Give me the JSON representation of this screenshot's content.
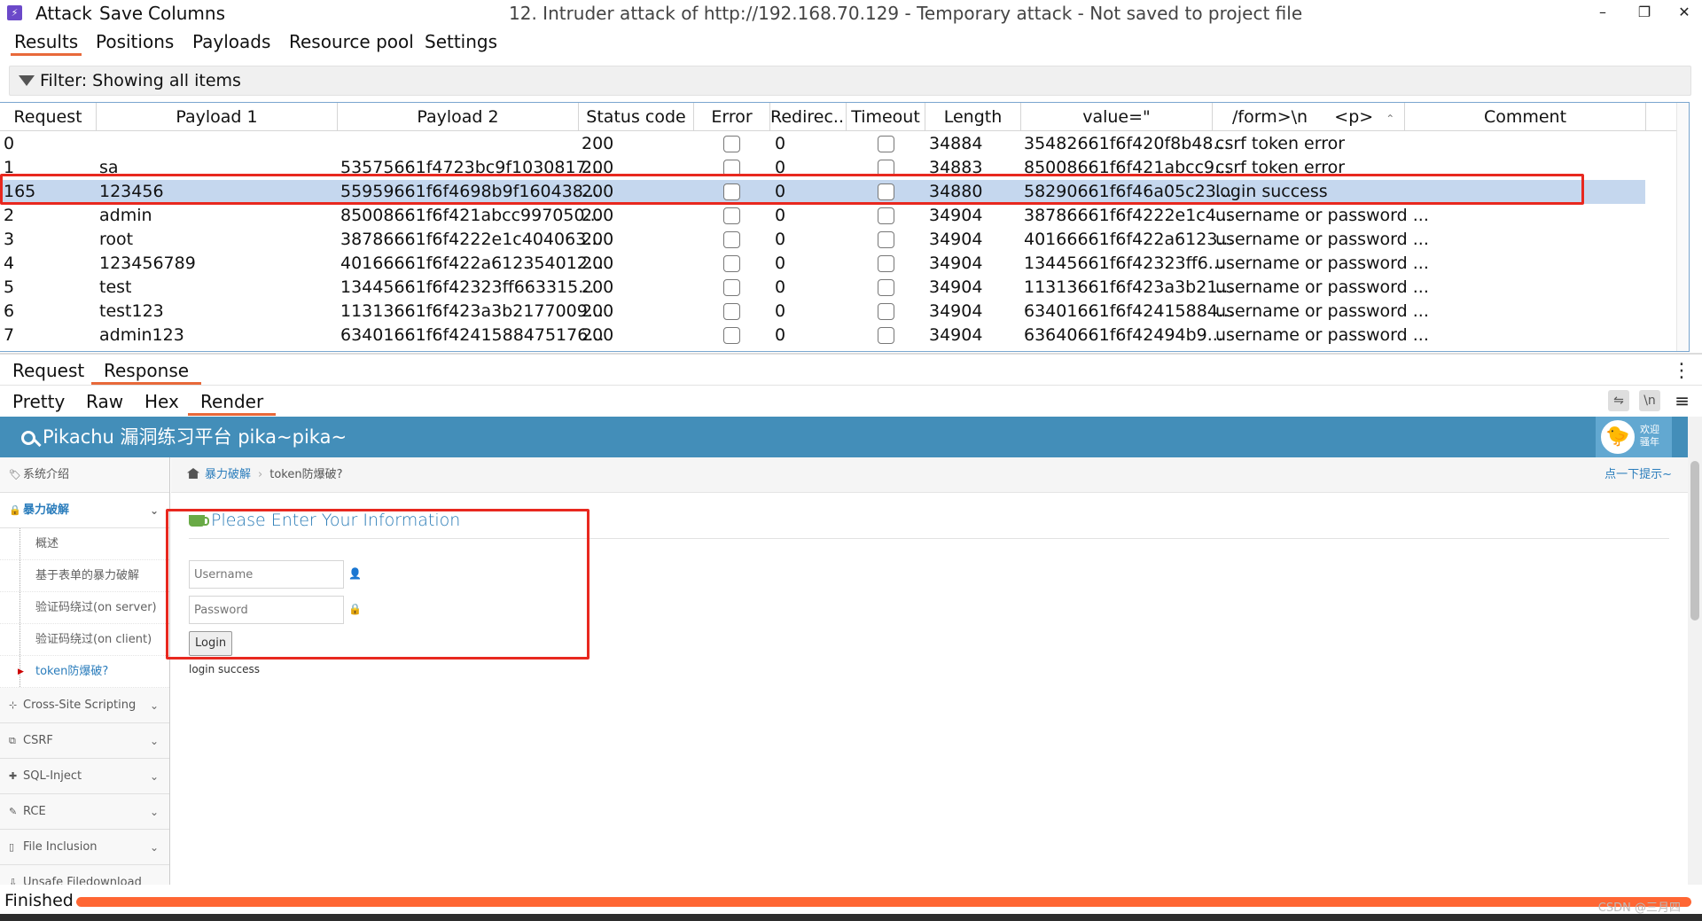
{
  "app": {
    "menu": [
      "Attack",
      "Save",
      "Columns"
    ],
    "title": "12. Intruder attack of http://192.168.70.129 - Temporary attack - Not saved to project file",
    "window_controls": [
      "–",
      "❐",
      "✕"
    ]
  },
  "main_tabs": [
    "Results",
    "Positions",
    "Payloads",
    "Resource pool",
    "Settings"
  ],
  "filter": {
    "label": "Filter: Showing all items"
  },
  "results": {
    "columns": [
      "Request",
      "Payload 1",
      "Payload 2",
      "Status code",
      "Error",
      "Redirec...",
      "Timeout",
      "Length",
      "value=\"",
      "/form>\\n",
      "<p>",
      "Comment"
    ],
    "rows": [
      [
        "0",
        "",
        "",
        "200",
        "",
        "0",
        "",
        "34884",
        "35482661f6f420f8b48...",
        "csrf token error"
      ],
      [
        "1",
        "sa",
        "53575661f4723bc9f1030817...",
        "200",
        "",
        "0",
        "",
        "34883",
        "85008661f6f421abcc9...",
        "csrf token error"
      ],
      [
        "165",
        "123456",
        "55959661f6f4698b9f160438...",
        "200",
        "",
        "0",
        "",
        "34880",
        "58290661f6f46a05c23...",
        "login success"
      ],
      [
        "2",
        "admin",
        "85008661f6f421abcc997050...",
        "200",
        "",
        "0",
        "",
        "34904",
        "38786661f6f4222e1c4...",
        "username or password ..."
      ],
      [
        "3",
        "root",
        "38786661f6f4222e1c404063...",
        "200",
        "",
        "0",
        "",
        "34904",
        "40166661f6f422a6123...",
        "username or password ..."
      ],
      [
        "4",
        "123456789",
        "40166661f6f422a612354012...",
        "200",
        "",
        "0",
        "",
        "34904",
        "13445661f6f42323ff6...",
        "username or password ..."
      ],
      [
        "5",
        "test",
        "13445661f6f42323ff663315...",
        "200",
        "",
        "0",
        "",
        "34904",
        "11313661f6f423a3b21...",
        "username or password ..."
      ],
      [
        "6",
        "test123",
        "11313661f6f423a3b2177009...",
        "200",
        "",
        "0",
        "",
        "34904",
        "63401661f6f42415884...",
        "username or password ..."
      ],
      [
        "7",
        "admin123",
        "63401661f6f4241588475176...",
        "200",
        "",
        "0",
        "",
        "34904",
        "63640661f6f42494b9...",
        "username or password ..."
      ]
    ],
    "selected_row": 2
  },
  "reqresp_tabs": [
    "Request",
    "Response"
  ],
  "view_tabs": [
    "Pretty",
    "Raw",
    "Hex",
    "Render"
  ],
  "view_tools": [
    "⇋",
    "\\n"
  ],
  "pikachu": {
    "brand": "Pikachu 漏洞练习平台 pika~pika~",
    "welcome": [
      "欢迎",
      "骚年"
    ],
    "sidebar": [
      {
        "label": "系统介绍",
        "expand": ""
      },
      {
        "label": "暴力破解",
        "expand": "⌄"
      },
      {
        "label": "Cross-Site Scripting",
        "expand": "⌄"
      },
      {
        "label": "CSRF",
        "expand": "⌄"
      },
      {
        "label": "SQL-Inject",
        "expand": "⌄"
      },
      {
        "label": "RCE",
        "expand": "⌄"
      },
      {
        "label": "File Inclusion",
        "expand": "⌄"
      },
      {
        "label": "Unsafe Filedownload",
        "expand": ""
      }
    ],
    "submenu": [
      "概述",
      "基于表单的暴力破解",
      "验证码绕过(on server)",
      "验证码绕过(on client)",
      "token防爆破?"
    ],
    "breadcrumb": [
      "暴力破解",
      "token防爆破?"
    ],
    "hint": "点一下提示~",
    "form_title": "Please Enter Your Information",
    "username_placeholder": "Username",
    "password_placeholder": "Password",
    "login_label": "Login",
    "message": "login success"
  },
  "status": {
    "text": "Finished",
    "progress": 1.0,
    "watermark": "CSDN @三月四"
  },
  "colors": {
    "accent_tab": "#e8693a",
    "selected_row": "#c5d7ee",
    "highlight_box": "#e8281f",
    "pikachu_header": "#438eb9",
    "progress": "#ff6633"
  }
}
